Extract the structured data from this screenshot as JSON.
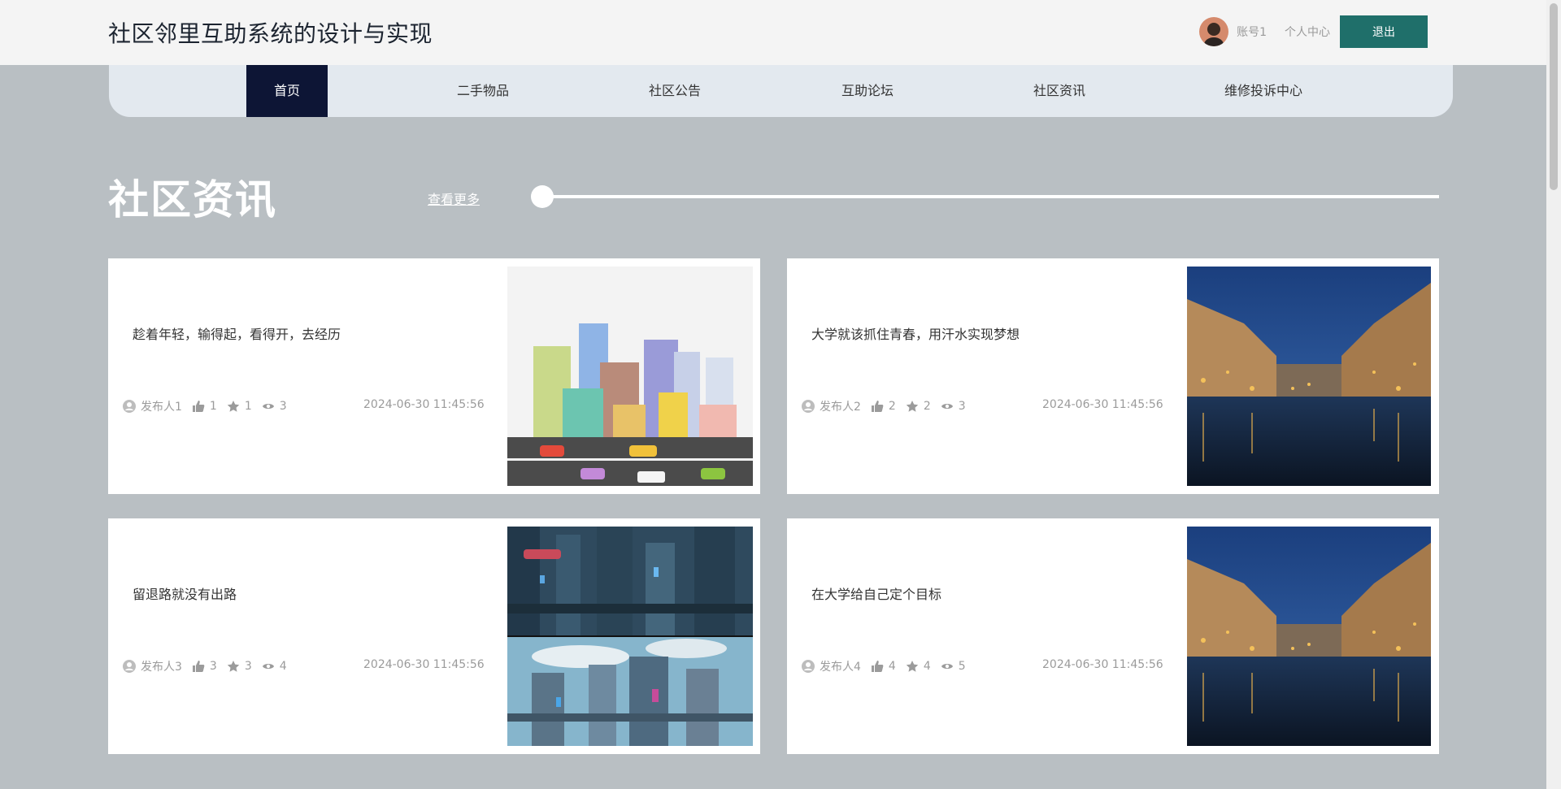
{
  "header": {
    "title": "社区邻里互助系统的设计与实现",
    "account": "账号1",
    "personal_center": "个人中心",
    "logout": "退出"
  },
  "nav": {
    "items": [
      {
        "label": "首页"
      },
      {
        "label": "二手物品"
      },
      {
        "label": "社区公告"
      },
      {
        "label": "互助论坛"
      },
      {
        "label": "社区资讯"
      },
      {
        "label": "维修投诉中心"
      }
    ],
    "active_index": 0
  },
  "section": {
    "title": "社区资讯",
    "more": "查看更多"
  },
  "cards": [
    {
      "title": "趁着年轻，输得起，看得开，去经历",
      "author": "发布人1",
      "likes": "1",
      "favorites": "1",
      "views": "3",
      "date": "2024-06-30 11:45:56",
      "image": "city-illustration"
    },
    {
      "title": "大学就该抓住青春，用汗水实现梦想",
      "author": "发布人2",
      "likes": "2",
      "favorites": "2",
      "views": "3",
      "date": "2024-06-30 11:45:56",
      "image": "canal-night"
    },
    {
      "title": "留退路就没有出路",
      "author": "发布人3",
      "likes": "3",
      "favorites": "3",
      "views": "4",
      "date": "2024-06-30 11:45:56",
      "image": "futuristic-city"
    },
    {
      "title": "在大学给自己定个目标",
      "author": "发布人4",
      "likes": "4",
      "favorites": "4",
      "views": "5",
      "date": "2024-06-30 11:45:56",
      "image": "canal-night"
    }
  ],
  "colors": {
    "page_bg": "#b9bfc3",
    "nav_active": "#0d1535",
    "logout_btn": "#1f6f6a"
  }
}
